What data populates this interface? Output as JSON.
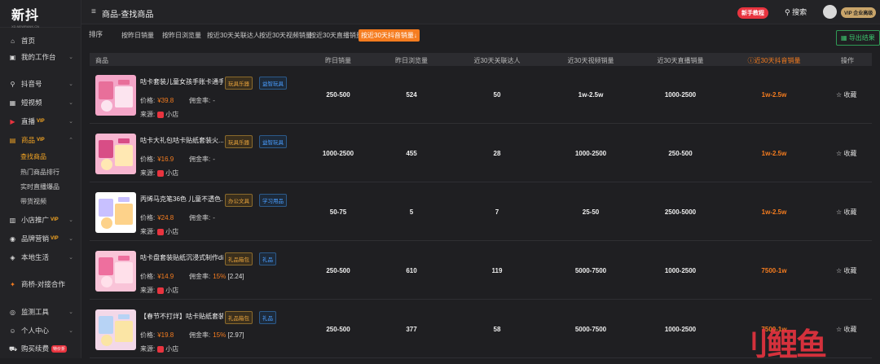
{
  "logo": {
    "title": "新抖",
    "subtitle": "XD.NEWRANK.CN"
  },
  "topbar": {
    "title": "商品-查找商品",
    "novice": "新手教程",
    "search": "搜索",
    "vip": "VIP 企业高级"
  },
  "sidebar": {
    "home": "首页",
    "workbench": "我的工作台",
    "douyin": "抖音号",
    "short_video": "短视频",
    "live": "直播",
    "live_vip": "VIP",
    "goods": "商品",
    "goods_vip": "VIP",
    "find_goods": "查找商品",
    "hot_rank": "热门商品排行",
    "live_goods": "实时直播爆品",
    "video_goods": "带货视频",
    "shop_promo": "小店推广",
    "shop_vip": "VIP",
    "brand": "品牌营销",
    "brand_vip": "VIP",
    "local": "本地生活",
    "bridge": "商桥-对接合作",
    "monitor": "监测工具",
    "personal": "个人中心",
    "renew": "购买续费",
    "renew_badge": "特价折"
  },
  "filter": {
    "label": "排序",
    "options": [
      "按昨日销量",
      "按昨日浏览量",
      "按近30天关联达人",
      "按近30天视频销量",
      "按近30天直播销量",
      "按近30天抖音销量↓"
    ],
    "export": "导出结果"
  },
  "table": {
    "headers": [
      "商品",
      "昨日销量",
      "昨日浏览量",
      "近30天关联达人",
      "近30天视频销量",
      "近30天直播销量",
      "近30天抖音销量",
      "操作"
    ],
    "price_label": "价格:",
    "comm_label": "佣金率:",
    "src_label": "来源:",
    "fav": "收藏",
    "rows": [
      {
        "title": "咕卡套装儿童女孩手账卡通手...",
        "tags": [
          "玩具乐器",
          "益智玩具"
        ],
        "price": "¥39.8",
        "comm": "-",
        "comm_x": "",
        "src": "小店",
        "c1": "250-500",
        "c2": "524",
        "c3": "50",
        "c4": "1w-2.5w",
        "c5": "1000-2500",
        "c6": "1w-2.5w"
      },
      {
        "title": "咕卡大礼包咕卡贴纸套装火...",
        "tags": [
          "玩具乐器",
          "益智玩具"
        ],
        "price": "¥16.9",
        "comm": "-",
        "comm_x": "",
        "src": "小店",
        "c1": "1000-2500",
        "c2": "455",
        "c3": "28",
        "c4": "1000-2500",
        "c5": "250-500",
        "c6": "1w-2.5w"
      },
      {
        "title": "丙烯马克笔36色 儿童不透色...",
        "tags": [
          "办公文具",
          "学习用品"
        ],
        "price": "¥24.8",
        "comm": "-",
        "comm_x": "",
        "src": "小店",
        "c1": "50-75",
        "c2": "5",
        "c3": "7",
        "c4": "25-50",
        "c5": "2500-5000",
        "c6": "1w-2.5w"
      },
      {
        "title": "咕卡盘套装贴纸沉浸式制作diy古...",
        "tags": [
          "礼品箱包",
          "礼品"
        ],
        "price": "¥14.9",
        "comm": "15%",
        "comm_x": "[2.24]",
        "src": "小店",
        "c1": "250-500",
        "c2": "610",
        "c3": "119",
        "c4": "5000-7500",
        "c5": "1000-2500",
        "c6": "7500-1w"
      },
      {
        "title": "【春节不打烊】咕卡贴纸套装咕...",
        "tags": [
          "礼品箱包",
          "礼品"
        ],
        "price": "¥19.8",
        "comm": "15%",
        "comm_x": "[2.97]",
        "src": "小店",
        "c1": "250-500",
        "c2": "377",
        "c3": "58",
        "c4": "5000-7500",
        "c5": "1000-2500",
        "c6": "7500-1w"
      }
    ]
  },
  "watermark": "鲤鱼"
}
